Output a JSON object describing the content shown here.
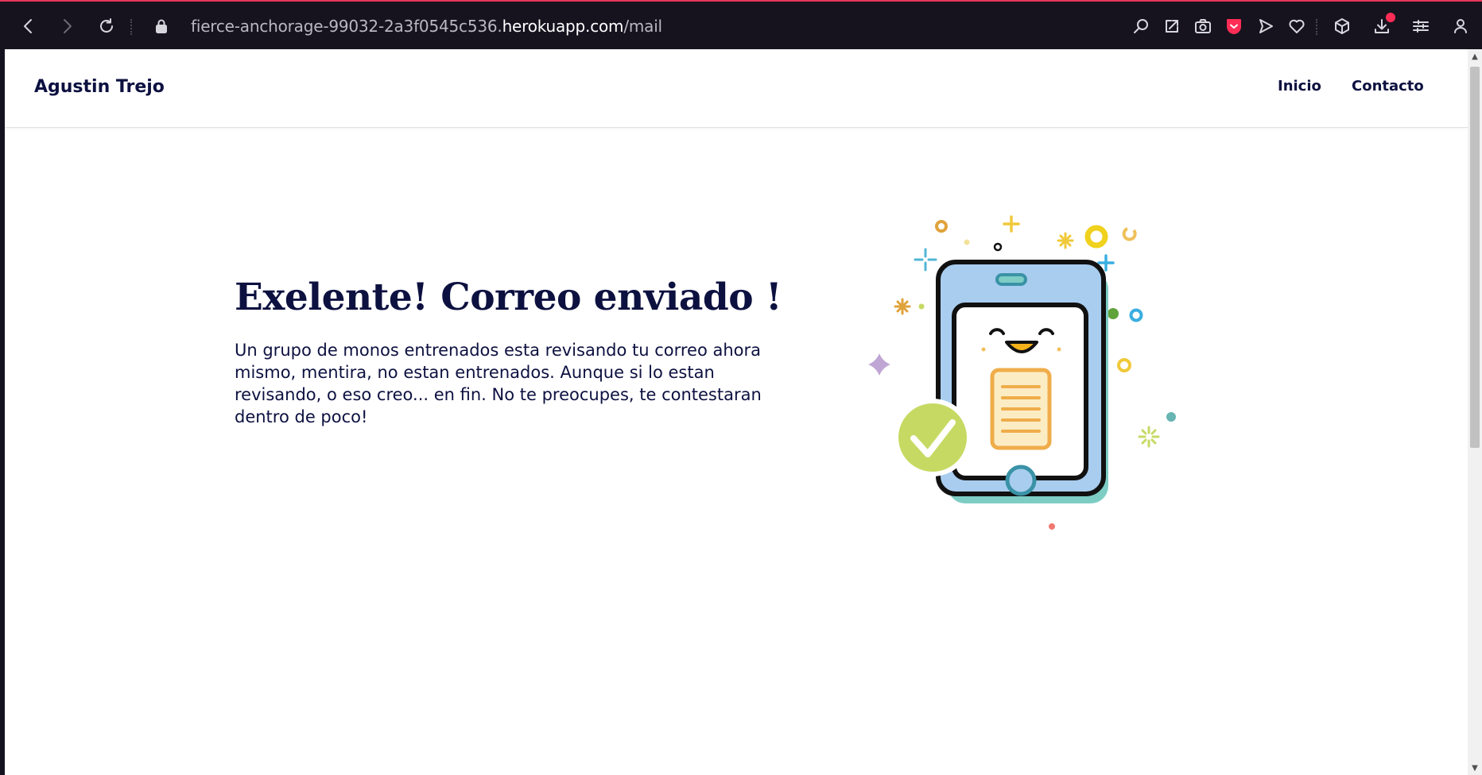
{
  "browser": {
    "url_prefix": "fierce-anchorage-99032-2a3f0545c536.",
    "url_host": "herokuapp.com",
    "url_path": "/mail",
    "toolbar_icons": [
      "back-icon",
      "forward-icon",
      "reload-icon",
      "lock-icon",
      "zoom-icon",
      "share-icon",
      "camera-icon",
      "shield-icon",
      "send-icon",
      "heart-icon",
      "cube-icon",
      "download-icon",
      "settings-icon",
      "profile-icon"
    ],
    "accent_color": "#e8365a"
  },
  "navbar": {
    "brand": "Agustin Trejo",
    "links": [
      {
        "label": "Inicio"
      },
      {
        "label": "Contacto"
      }
    ]
  },
  "main": {
    "headline": "Exelente! Correo enviado !",
    "message": "Un grupo de monos entrenados esta revisando tu correo ahora mismo, mentira, no estan entrenados. Aunque si lo estan revisando, o eso creo... en fin. No te preocupes, te contestaran dentro de poco!",
    "illustration": "phone-mail-sent-illustration"
  },
  "colors": {
    "text": "#0d1140",
    "phone_screen": "#a8cdef",
    "check": "#c6da63",
    "document": "#efad4a"
  }
}
